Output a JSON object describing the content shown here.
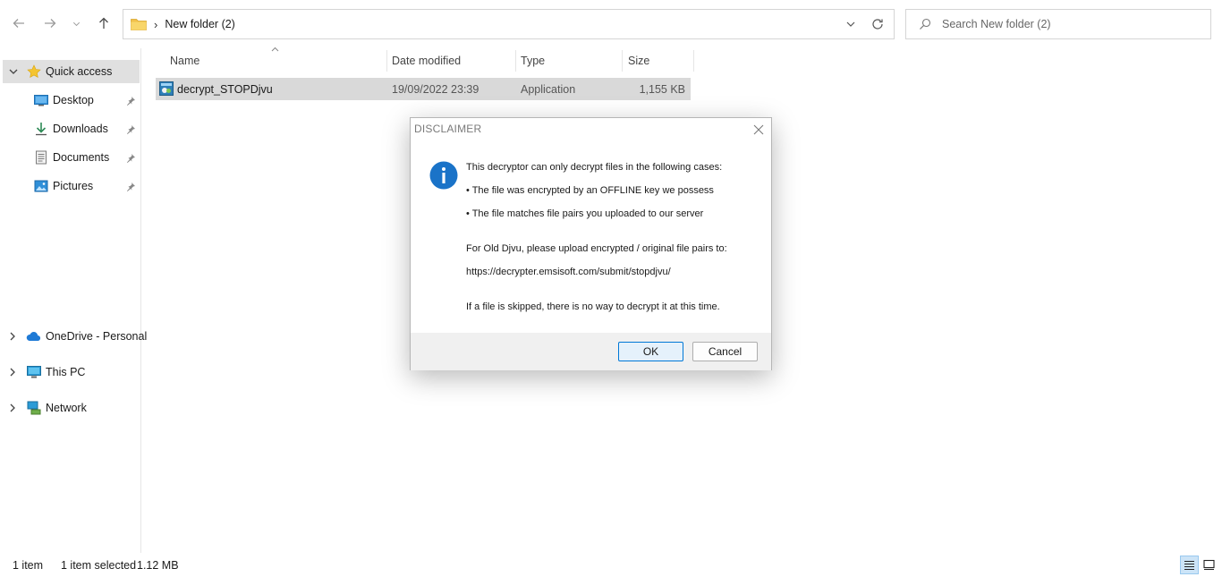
{
  "address": {
    "path": "New folder (2)"
  },
  "search": {
    "placeholder": "Search New folder (2)"
  },
  "sidebar": {
    "quick_access": "Quick access",
    "pinned": [
      {
        "label": "Desktop",
        "icon": "desktop-icon"
      },
      {
        "label": "Downloads",
        "icon": "download-icon"
      },
      {
        "label": "Documents",
        "icon": "document-icon"
      },
      {
        "label": "Pictures",
        "icon": "picture-icon"
      }
    ],
    "onedrive": "OneDrive - Personal",
    "this_pc": "This PC",
    "network": "Network"
  },
  "columns": {
    "name": "Name",
    "date": "Date modified",
    "type": "Type",
    "size": "Size"
  },
  "files": [
    {
      "name": "decrypt_STOPDjvu",
      "date": "19/09/2022 23:39",
      "type": "Application",
      "size": "1,155 KB"
    }
  ],
  "status": {
    "count": "1 item",
    "selected": "1 item selected",
    "size": "1.12 MB"
  },
  "dialog": {
    "title": "DISCLAIMER",
    "line1": "This decryptor can only decrypt files in the following cases:",
    "line2": "• The file was encrypted by an OFFLINE key we possess",
    "line3": "• The file matches file pairs you uploaded to our server",
    "line4": "For Old Djvu, please upload encrypted / original file pairs to:",
    "line5": "https://decrypter.emsisoft.com/submit/stopdjvu/",
    "line6": "If a file is skipped, there is no way to decrypt it at this time.",
    "ok": "OK",
    "cancel": "Cancel"
  },
  "colors": {
    "selection": "#d9d9d9",
    "accent": "#0078d7",
    "info_blue": "#1a73c8"
  }
}
